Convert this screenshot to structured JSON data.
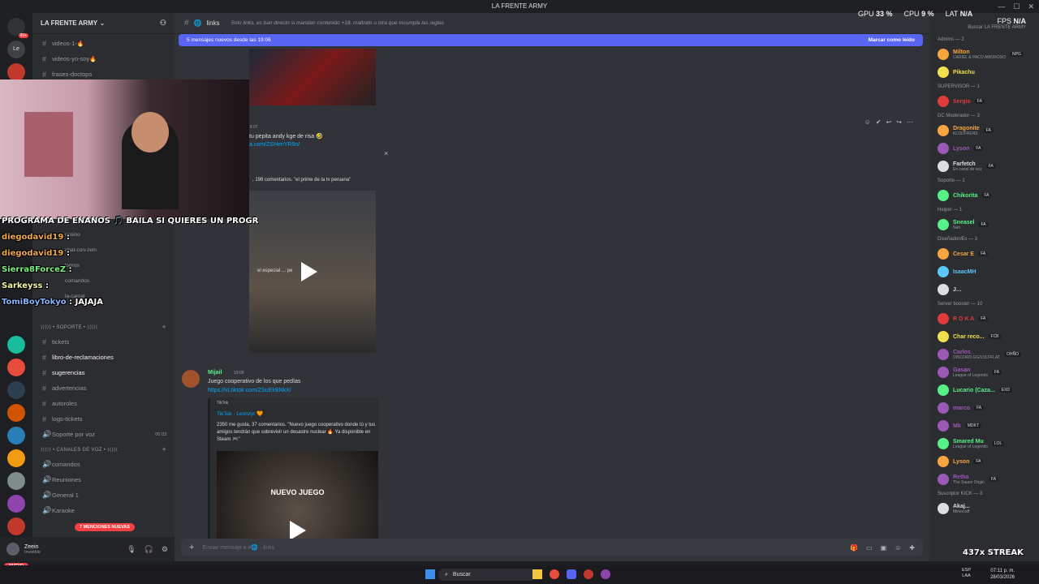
{
  "window": {
    "title": "LA FRENTE ARMY"
  },
  "server": {
    "name": "LA FRENTE ARMY",
    "unread_badge": "99+"
  },
  "channels": [
    {
      "name": "videos-1-",
      "emoji": "🔥"
    },
    {
      "name": "videos-yo-soy",
      "emoji": "🔥"
    },
    {
      "name": "frases-doctops",
      "emoji": ""
    }
  ],
  "overlay_channels": [
    "casino",
    "chat-con-zein",
    "logros",
    "comandos",
    "la-carcel"
  ],
  "categories": {
    "soporte": "⟩⟩⟩⟩⟩ • SOPORTE • ⟨⟨⟨⟨⟨",
    "voz": "⟩⟩⟩⟩⟩ • CANALES DE VOZ • ⟨⟨⟨⟨⟨"
  },
  "support_channels": [
    {
      "name": "tickets",
      "bright": false
    },
    {
      "name": "libro-de-reclamaciones",
      "bright": true
    },
    {
      "name": "sugerencias",
      "bright": true
    },
    {
      "name": "advertencias",
      "bright": false
    },
    {
      "name": "autoroles",
      "bright": false
    },
    {
      "name": "logs-tickets",
      "bright": false
    },
    {
      "name": "Soporte por voz",
      "bright": false,
      "counts": "00  03"
    }
  ],
  "voice_channels": [
    {
      "name": "comandos"
    },
    {
      "name": "Reuniones"
    },
    {
      "name": "General 1"
    },
    {
      "name": "Karaoke"
    }
  ],
  "mentions_pill": "7 MENCIONES NUEVAS",
  "new_pill": "NUEVO",
  "user": {
    "name": "Zeein",
    "status": "Invisible"
  },
  "channel": {
    "name": "links",
    "topic": "Solo links, es ban directo si mandan contenido +18, maltrato u otra que incumpla las reglas"
  },
  "new_messages_bar": {
    "text": "5 mensajes nuevos desde las 19:06",
    "mark_read": "Marcar como leído"
  },
  "messages": [
    {
      "time": "19:07",
      "text": "tu pepita andy kge de risa 🤣",
      "link": "a.com/ZSHenYR9n/",
      "embed_stats": ", 198 comentarios. \"el prime de la tv peruana\"",
      "video_caption": "el especial ... pe"
    },
    {
      "author": "Mijail",
      "time": "19:09",
      "text": "Juego cooperativo de los que pedías",
      "link": "https://vt.tiktok.com/ZSuEkBNkX/",
      "embed_site": "TikTok",
      "embed_author": "TikTok · Leonzyr 🧡",
      "embed_desc": "2350 me gusta, 37 comentarios. \"Nuevo juego cooperativo donde tú y tus amigos tendrán que sobrevivir un desastre nuclear 🔥 Ya disponible en Steam 🎮\"",
      "video_title": "NUEVO JUEGO"
    }
  ],
  "composer": {
    "placeholder": "Enviar mensaje a #🌐 · links"
  },
  "search": {
    "placeholder": "Buscar LA FRENTE ARMY"
  },
  "stats": {
    "fps_label": "FPS",
    "fps_value": "N/A",
    "gpu_label": "GPU",
    "gpu_value": "33 %",
    "cpu_label": "CPU",
    "cpu_value": "9 %",
    "lat_label": "LAT",
    "lat_value": "N/A"
  },
  "member_groups": [
    {
      "role": "Admins — 2",
      "members": [
        {
          "name": "Milton",
          "color": "#f7a63e",
          "sub": "CARIEL & PACO AMOROSO",
          "tag": "NPG"
        },
        {
          "name": "Pikachu",
          "color": "#f0e04a",
          "sub": ""
        }
      ]
    },
    {
      "role": "SUPERVISOR — 1",
      "members": [
        {
          "name": "Sergio",
          "color": "#e03b3b",
          "sub": "",
          "tag": "FA"
        }
      ]
    },
    {
      "role": "DC Moderador — 3",
      "members": [
        {
          "name": "Dragonite",
          "color": "#f7a63e",
          "sub": "KLOUFRENS",
          "tag": "FA"
        },
        {
          "name": "Lyson",
          "color": "#9b59b6",
          "sub": "",
          "tag": "FA"
        },
        {
          "name": "Farfetch",
          "color": "#dbdee1",
          "sub": "En canal de voz",
          "tag": "FA"
        }
      ]
    },
    {
      "role": "Soporte — 1",
      "members": [
        {
          "name": "Chikorita",
          "color": "#57f287",
          "sub": "",
          "tag": "FA"
        }
      ]
    },
    {
      "role": "Helper — 1",
      "members": [
        {
          "name": "Sneasel",
          "color": "#57f287",
          "sub": "Nah",
          "tag": "FA"
        }
      ]
    },
    {
      "role": "DiseñadorÆs — 3",
      "members": [
        {
          "name": "Cesar E",
          "color": "#f7a63e",
          "sub": "",
          "tag": "FA"
        },
        {
          "name": "IsaacMH",
          "color": "#5ac8fa",
          "sub": ""
        },
        {
          "name": "J…",
          "color": "#dbdee1",
          "sub": ""
        }
      ]
    },
    {
      "role": "Server booster — 10",
      "members": [
        {
          "name": "R O K A",
          "color": "#e03b3b",
          "sub": "",
          "tag": "FA"
        },
        {
          "name": "Char reco...",
          "color": "#f0e04a",
          "sub": "",
          "tag": "FCB"
        },
        {
          "name": "Carlos_",
          "color": "#9b59b6",
          "sub": "DISCORD.GG/LOLFFLAT",
          "tag": "OHÑO"
        },
        {
          "name": "Gasan",
          "color": "#9b59b6",
          "sub": "League of Legends",
          "tag": "FA"
        },
        {
          "name": "Lucario (Caza...",
          "color": "#57f287",
          "sub": "",
          "tag": "EXD"
        },
        {
          "name": "marco",
          "color": "#9b59b6",
          "sub": "",
          "tag": "FA"
        },
        {
          "name": "Mk",
          "color": "#9b59b6",
          "sub": "",
          "tag": "MDKT"
        },
        {
          "name": "Smared Mu",
          "color": "#57f287",
          "sub": "League of Legends",
          "tag": "LOL"
        },
        {
          "name": "Lyson",
          "color": "#f7a63e",
          "sub": "",
          "tag": "FA"
        },
        {
          "name": "Retha",
          "color": "#9b59b6",
          "sub": "The Sauce Origin",
          "tag": "FA"
        }
      ]
    },
    {
      "role": "Suscriptor KICK — 3",
      "members": [
        {
          "name": "Akaj...",
          "color": "#dbdee1",
          "sub": "Minecraft"
        }
      ]
    }
  ],
  "stream_overlay": {
    "banner": "PROGRAMA DE ENANOS  🎵  BAILA SI QUIERES UN PROGR",
    "chat": [
      {
        "user": "diegodavid19",
        "text": ":"
      },
      {
        "user": "diegodavid19",
        "text": ":"
      },
      {
        "user": "Sierra8ForceZ",
        "text": ":"
      },
      {
        "user": "Sarkeyss",
        "text": ":"
      },
      {
        "user": "TomiBoyTokyo",
        "text": ": JAJAJA"
      }
    ],
    "streak": "437x STREAK"
  },
  "taskbar": {
    "search": "Buscar",
    "lang_top": "ESP",
    "lang_bottom": "LAA",
    "time": "07:11 p. m.",
    "date": "28/03/2026"
  }
}
